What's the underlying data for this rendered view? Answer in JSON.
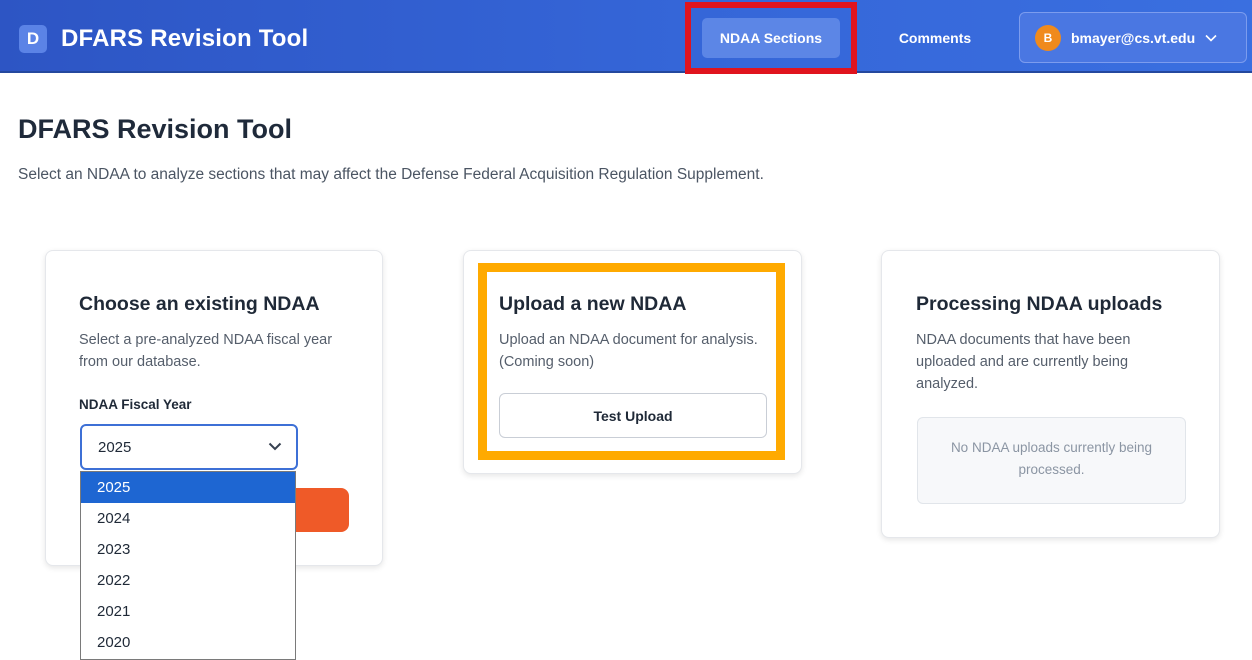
{
  "header": {
    "brand_letter": "D",
    "brand_title": "DFARS Revision Tool",
    "nav": {
      "ndaa_sections": "NDAA Sections",
      "comments": "Comments"
    },
    "user": {
      "initial": "B",
      "email": "bmayer@cs.vt.edu",
      "chevron": "﹀"
    }
  },
  "page": {
    "title": "DFARS Revision Tool",
    "subtitle": "Select an NDAA to analyze sections that may affect the Defense Federal Acquisition Regulation Supplement."
  },
  "cards": {
    "existing": {
      "title": "Choose an existing NDAA",
      "description": "Select a pre-analyzed NDAA fiscal year from our database.",
      "field_label": "NDAA Fiscal Year",
      "selected_value": "2025",
      "options": [
        "2025",
        "2024",
        "2023",
        "2022",
        "2021",
        "2020"
      ]
    },
    "upload": {
      "title": "Upload a new NDAA",
      "description": "Upload an NDAA document for analysis. (Coming soon)",
      "button_label": "Test Upload"
    },
    "processing": {
      "title": "Processing NDAA uploads",
      "description": "NDAA documents that have been uploaded and are currently being analyzed.",
      "empty_message": "No NDAA uploads currently being processed."
    }
  },
  "colors": {
    "header_blue": "#3566d8",
    "accent_orange": "#ef5a28",
    "highlight_red": "#e0141e",
    "highlight_yellow": "#ffaa00",
    "selected_option": "#1e66d2"
  },
  "icons": {
    "select_chevron": "chevron-down-icon",
    "user_chevron": "chevron-down-icon"
  }
}
